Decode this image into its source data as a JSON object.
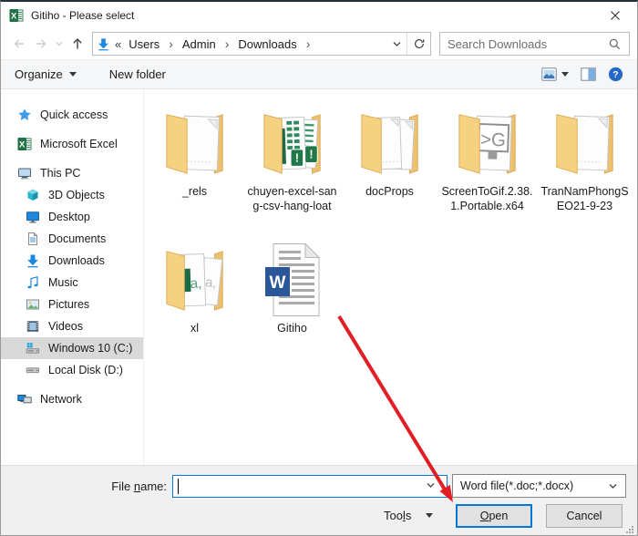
{
  "window": {
    "title": "Gitiho - Please select"
  },
  "colors": {
    "accent": "#0078d7",
    "arrow_red": "#e21e25",
    "folder_front": "#f6d181",
    "excel_green": "#217346",
    "word_blue": "#2b579a",
    "selected_row": "#d9d9d9"
  },
  "nav": {
    "address": {
      "collapse_glyph": "«",
      "separator_glyph": "›",
      "crumbs": [
        "Users",
        "Admin",
        "Downloads"
      ]
    },
    "search": {
      "placeholder": "Search Downloads"
    }
  },
  "toolbar": {
    "organize_label": "Organize",
    "new_folder_label": "New folder"
  },
  "sidebar": {
    "items": [
      {
        "label": "Quick access",
        "icon": "star"
      },
      {
        "label": "Microsoft Excel",
        "icon": "excel"
      },
      {
        "label": "This PC",
        "icon": "computer"
      },
      {
        "label": "3D Objects",
        "icon": "cube"
      },
      {
        "label": "Desktop",
        "icon": "monitor"
      },
      {
        "label": "Documents",
        "icon": "document"
      },
      {
        "label": "Downloads",
        "icon": "download-arrow"
      },
      {
        "label": "Music",
        "icon": "music-note"
      },
      {
        "label": "Pictures",
        "icon": "picture"
      },
      {
        "label": "Videos",
        "icon": "film"
      },
      {
        "label": "Windows 10 (C:)",
        "icon": "drive-windows",
        "selected": true
      },
      {
        "label": "Local Disk (D:)",
        "icon": "drive"
      },
      {
        "label": "Network",
        "icon": "network"
      }
    ]
  },
  "files": {
    "items": [
      {
        "label": "_rels",
        "type": "folder"
      },
      {
        "label": "chuyen-excel-sang-csv-hang-loat",
        "type": "folder-excel"
      },
      {
        "label": "docProps",
        "type": "folder"
      },
      {
        "label": "ScreenToGif.2.38.1.Portable.x64",
        "type": "folder-app"
      },
      {
        "label": "TranNamPhongSEO21-9-23",
        "type": "folder"
      },
      {
        "label": "xl",
        "type": "folder-xml"
      },
      {
        "label": "Gitiho",
        "type": "word-doc"
      }
    ]
  },
  "footer": {
    "file_name_label": {
      "pre": "File ",
      "key": "n",
      "post": "ame:"
    },
    "file_name_value": "",
    "file_type_value": "Word file(*.doc;*.docx)",
    "tools": {
      "pre": "Too",
      "key": "l",
      "post": "s"
    },
    "open": {
      "pre": "",
      "key": "O",
      "post": "pen"
    },
    "cancel_label": "Cancel"
  },
  "icons": {
    "help_glyph": "?",
    "excel_glyph": "X",
    "word_glyph": "W",
    "screentogif_glyph": ">G",
    "xml_glyph": "a,",
    "alert_glyph": "!"
  }
}
